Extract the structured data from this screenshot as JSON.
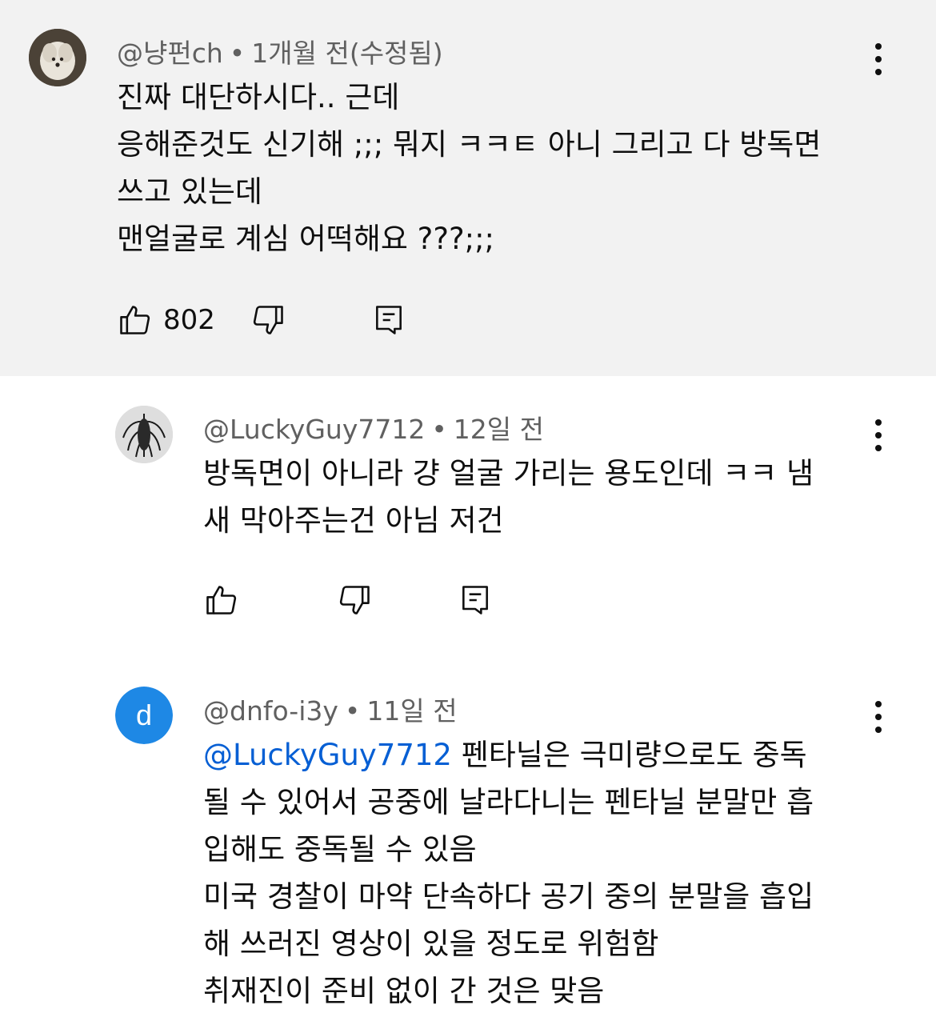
{
  "comments": [
    {
      "author": "@냥펀ch",
      "separator": "•",
      "time": "1개월 전(수정됨)",
      "lines": [
        "진짜 대단하시다.. 근데",
        "응해준것도 신기해 ;;; 뭐지 ㅋㅋㅌ 아니 그리고 다 방독면",
        "쓰고 있는데",
        "맨얼굴로 계심 어떡해요 ???;;;"
      ],
      "like_count": "802",
      "like_icon": "thumbs-up-icon",
      "dislike_icon": "thumbs-down-icon",
      "reply_icon": "reply-icon",
      "menu_icon": "more-vert-icon"
    },
    {
      "author": "@LuckyGuy7712",
      "separator": "•",
      "time": "12일 전",
      "lines": [
        "방독면이 아니라 걍 얼굴 가리는 용도인데 ㅋㅋ 냄",
        "새 막아주는건 아님 저건"
      ],
      "like_icon": "thumbs-up-icon",
      "dislike_icon": "thumbs-down-icon",
      "reply_icon": "reply-icon",
      "menu_icon": "more-vert-icon"
    },
    {
      "author": "@dnfo-i3y",
      "separator": "•",
      "time": "11일 전",
      "avatar_letter": "d",
      "avatar_color": "#1e88e5",
      "mention": "@LuckyGuy7712",
      "first_line_rest": " 펜타닐은 극미량으로도 중독",
      "lines": [
        "될 수 있어서 공중에 날라다니는 펜타닐 분말만 흡",
        "입해도 중독될 수 있음",
        "미국 경찰이 마약 단속하다 공기 중의 분말을 흡입",
        "해 쓰러진 영상이 있을 정도로 위험함",
        "취재진이 준비 없이 간 것은 맞음"
      ],
      "menu_icon": "more-vert-icon"
    }
  ],
  "colors": {
    "highlight_bg": "#f2f2f2",
    "meta_text": "#606060",
    "mention": "#065fd4",
    "avatar_d": "#1e88e5"
  }
}
